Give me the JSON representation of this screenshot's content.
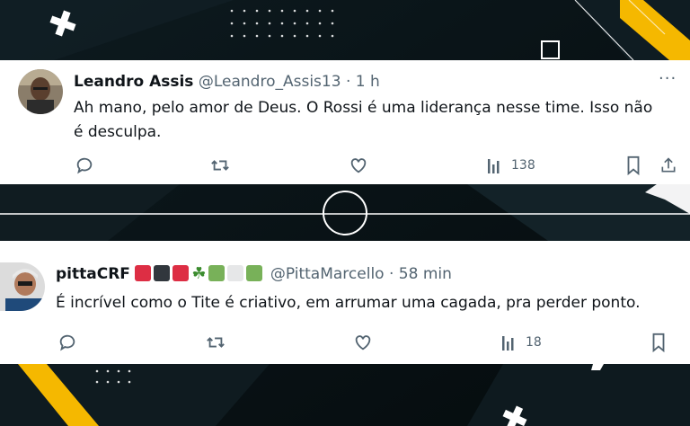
{
  "tweets": [
    {
      "name": "Leandro Assis",
      "handle": "@Leandro_Assis13",
      "separator": "·",
      "time": "1 h",
      "more": "···",
      "text": "Ah mano, pelo amor de Deus. O Rossi é uma liderança nesse time. Isso não é desculpa.",
      "views": "138"
    },
    {
      "name": "pittaCRF",
      "name_emojis": [
        "red-square",
        "black-square",
        "red-square",
        "shamrock",
        "green-square",
        "white-square",
        "green-square"
      ],
      "shamrock_glyph": "☘",
      "handle": "@PittaMarcello",
      "separator": "·",
      "time": "58 min",
      "text": "É incrível como o Tite é criativo, em arrumar uma cagada, pra perder ponto.",
      "views": "18"
    }
  ],
  "colors": {
    "accent_yellow": "#f5b800",
    "background": "#0b1418",
    "icon_gray": "#536471",
    "emoji_red": "#dd2e44",
    "emoji_black": "#31373d",
    "emoji_green": "#78b159",
    "emoji_white": "#e6e7e8"
  }
}
